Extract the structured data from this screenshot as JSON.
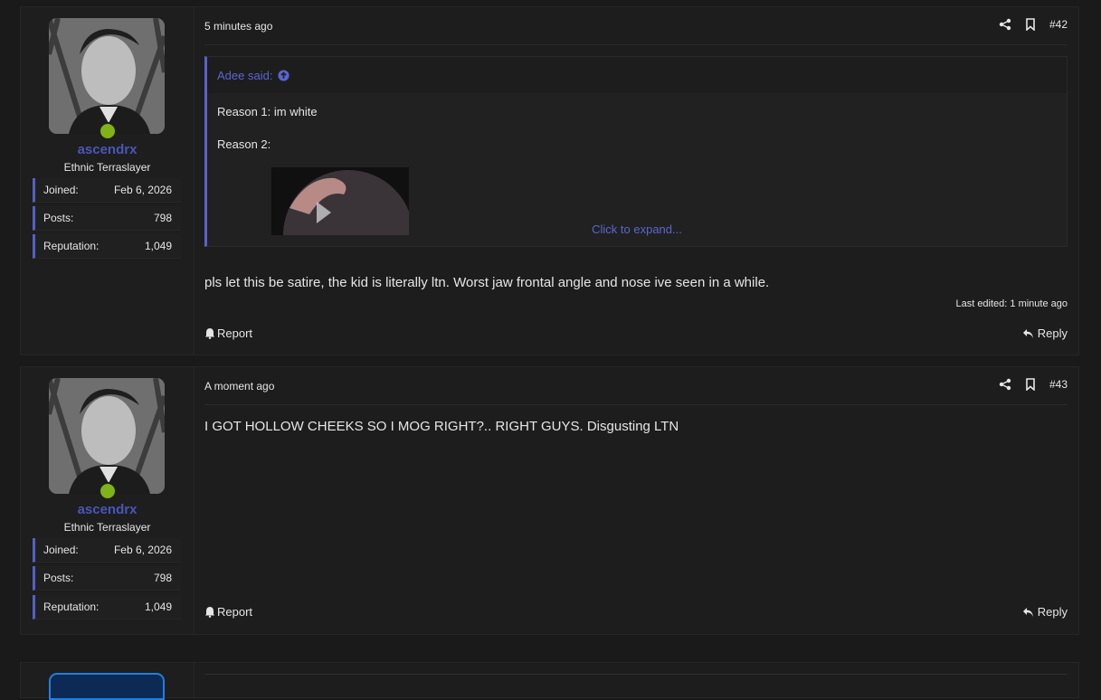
{
  "colors": {
    "accent": "#5460c4",
    "link": "#5a66d0",
    "username": "#4a56b8",
    "online": "#7fb319",
    "background": "#1a1a1a"
  },
  "posts": [
    {
      "time": "5 minutes ago",
      "number": "#42",
      "user": {
        "name": "ascendrx",
        "title": "Ethnic Terraslayer",
        "stats": [
          {
            "label": "Joined:",
            "value": "Feb 6, 2026"
          },
          {
            "label": "Posts:",
            "value": "798"
          },
          {
            "label": "Reputation:",
            "value": "1,049"
          }
        ]
      },
      "quote": {
        "author": "Adee said:",
        "lines": [
          "Reason 1: im white",
          "Reason 2:"
        ],
        "expand_label": "Click to expand..."
      },
      "body": "pls let this be satire, the kid is literally ltn. Worst jaw frontal angle and nose ive seen in a while.",
      "edited": "Last edited: 1 minute ago",
      "report_label": "Report",
      "reply_label": "Reply"
    },
    {
      "time": "A moment ago",
      "number": "#43",
      "user": {
        "name": "ascendrx",
        "title": "Ethnic Terraslayer",
        "stats": [
          {
            "label": "Joined:",
            "value": "Feb 6, 2026"
          },
          {
            "label": "Posts:",
            "value": "798"
          },
          {
            "label": "Reputation:",
            "value": "1,049"
          }
        ]
      },
      "body": "I GOT HOLLOW CHEEKS SO I MOG RIGHT?.. RIGHT GUYS. Disgusting LTN",
      "report_label": "Report",
      "reply_label": "Reply"
    }
  ]
}
